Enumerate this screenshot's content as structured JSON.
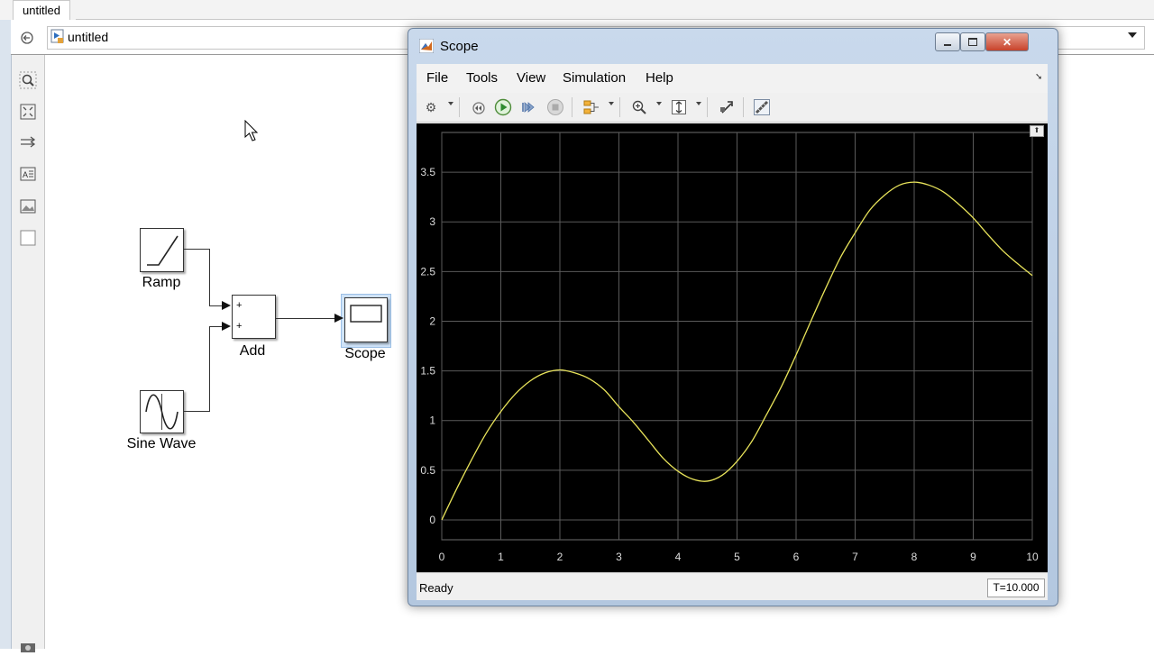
{
  "editor": {
    "tab_label": "untitled",
    "address_label": "untitled"
  },
  "model": {
    "blocks": {
      "ramp": "Ramp",
      "sine": "Sine Wave",
      "add": "Add",
      "scope": "Scope"
    },
    "add_port_signs": [
      "+",
      "+"
    ]
  },
  "scope_window": {
    "title": "Scope",
    "menu": [
      "File",
      "Tools",
      "View",
      "Simulation",
      "Help"
    ],
    "status": "Ready",
    "time": "T=10.000"
  },
  "chart_data": {
    "type": "line",
    "xlim": [
      0,
      10
    ],
    "ylim": [
      -0.2,
      3.9
    ],
    "xticks": [
      0,
      1,
      2,
      3,
      4,
      5,
      6,
      7,
      8,
      9,
      10
    ],
    "yticks": [
      0,
      0.5,
      1,
      1.5,
      2,
      2.5,
      3,
      3.5
    ],
    "grid": true,
    "background": "#000000",
    "line_color": "#e8e35a",
    "x": [
      0,
      0.25,
      0.5,
      0.75,
      1,
      1.25,
      1.5,
      1.75,
      2,
      2.25,
      2.5,
      2.75,
      3,
      3.25,
      3.5,
      3.75,
      4,
      4.25,
      4.5,
      4.75,
      5,
      5.25,
      5.5,
      5.75,
      6,
      6.25,
      6.5,
      6.75,
      7,
      7.25,
      7.5,
      7.75,
      8,
      8.25,
      8.5,
      8.75,
      9,
      9.25,
      9.5,
      9.75,
      10
    ],
    "y": [
      0,
      0.31,
      0.6,
      0.87,
      1.09,
      1.27,
      1.4,
      1.48,
      1.51,
      1.48,
      1.42,
      1.31,
      1.14,
      0.98,
      0.8,
      0.62,
      0.49,
      0.41,
      0.39,
      0.45,
      0.59,
      0.79,
      1.06,
      1.34,
      1.66,
      2.0,
      2.33,
      2.64,
      2.89,
      3.12,
      3.27,
      3.37,
      3.4,
      3.37,
      3.3,
      3.18,
      3.04,
      2.87,
      2.71,
      2.58,
      2.46
    ]
  }
}
